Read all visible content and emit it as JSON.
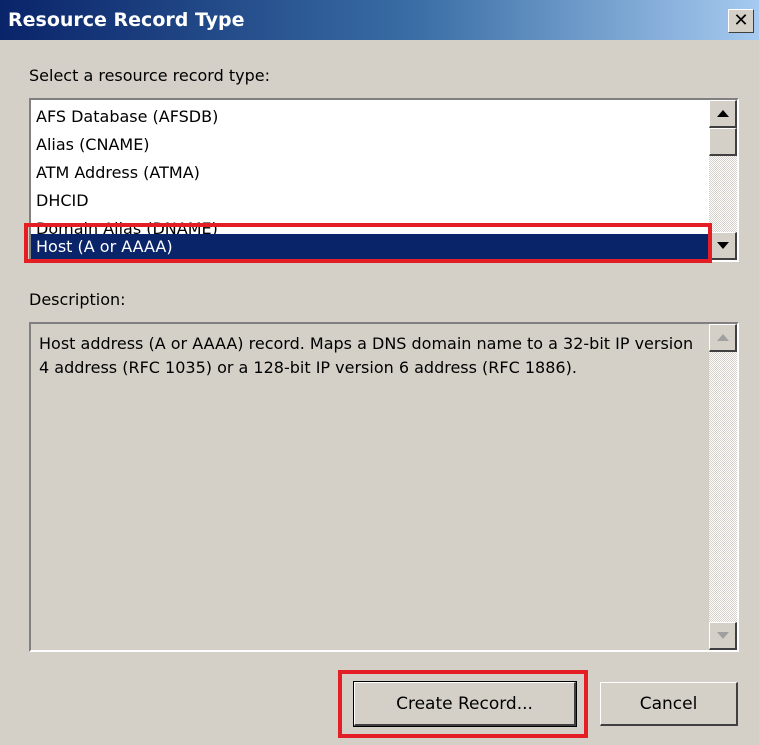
{
  "window": {
    "title": "Resource Record Type",
    "close_label": "✕"
  },
  "record_type_list": {
    "label": "Select a resource record type:",
    "items": [
      "AFS Database (AFSDB)",
      "Alias (CNAME)",
      "ATM Address (ATMA)",
      "DHCID",
      "Domain Alias (DNAME)",
      "Host (A or AAAA)"
    ],
    "selected": "Host (A or AAAA)"
  },
  "description": {
    "label": "Description:",
    "text": "Host address (A or AAAA) record. Maps a DNS domain name to a 32-bit IP version 4 address (RFC 1035) or a 128-bit IP version 6 address (RFC 1886)."
  },
  "buttons": {
    "create_record": "Create Record...",
    "cancel": "Cancel"
  },
  "colors": {
    "title_bar_start": "#0a246a",
    "selection": "#0a246a",
    "highlight_box": "#e31e24",
    "dialog_background": "#d4d0c8"
  }
}
